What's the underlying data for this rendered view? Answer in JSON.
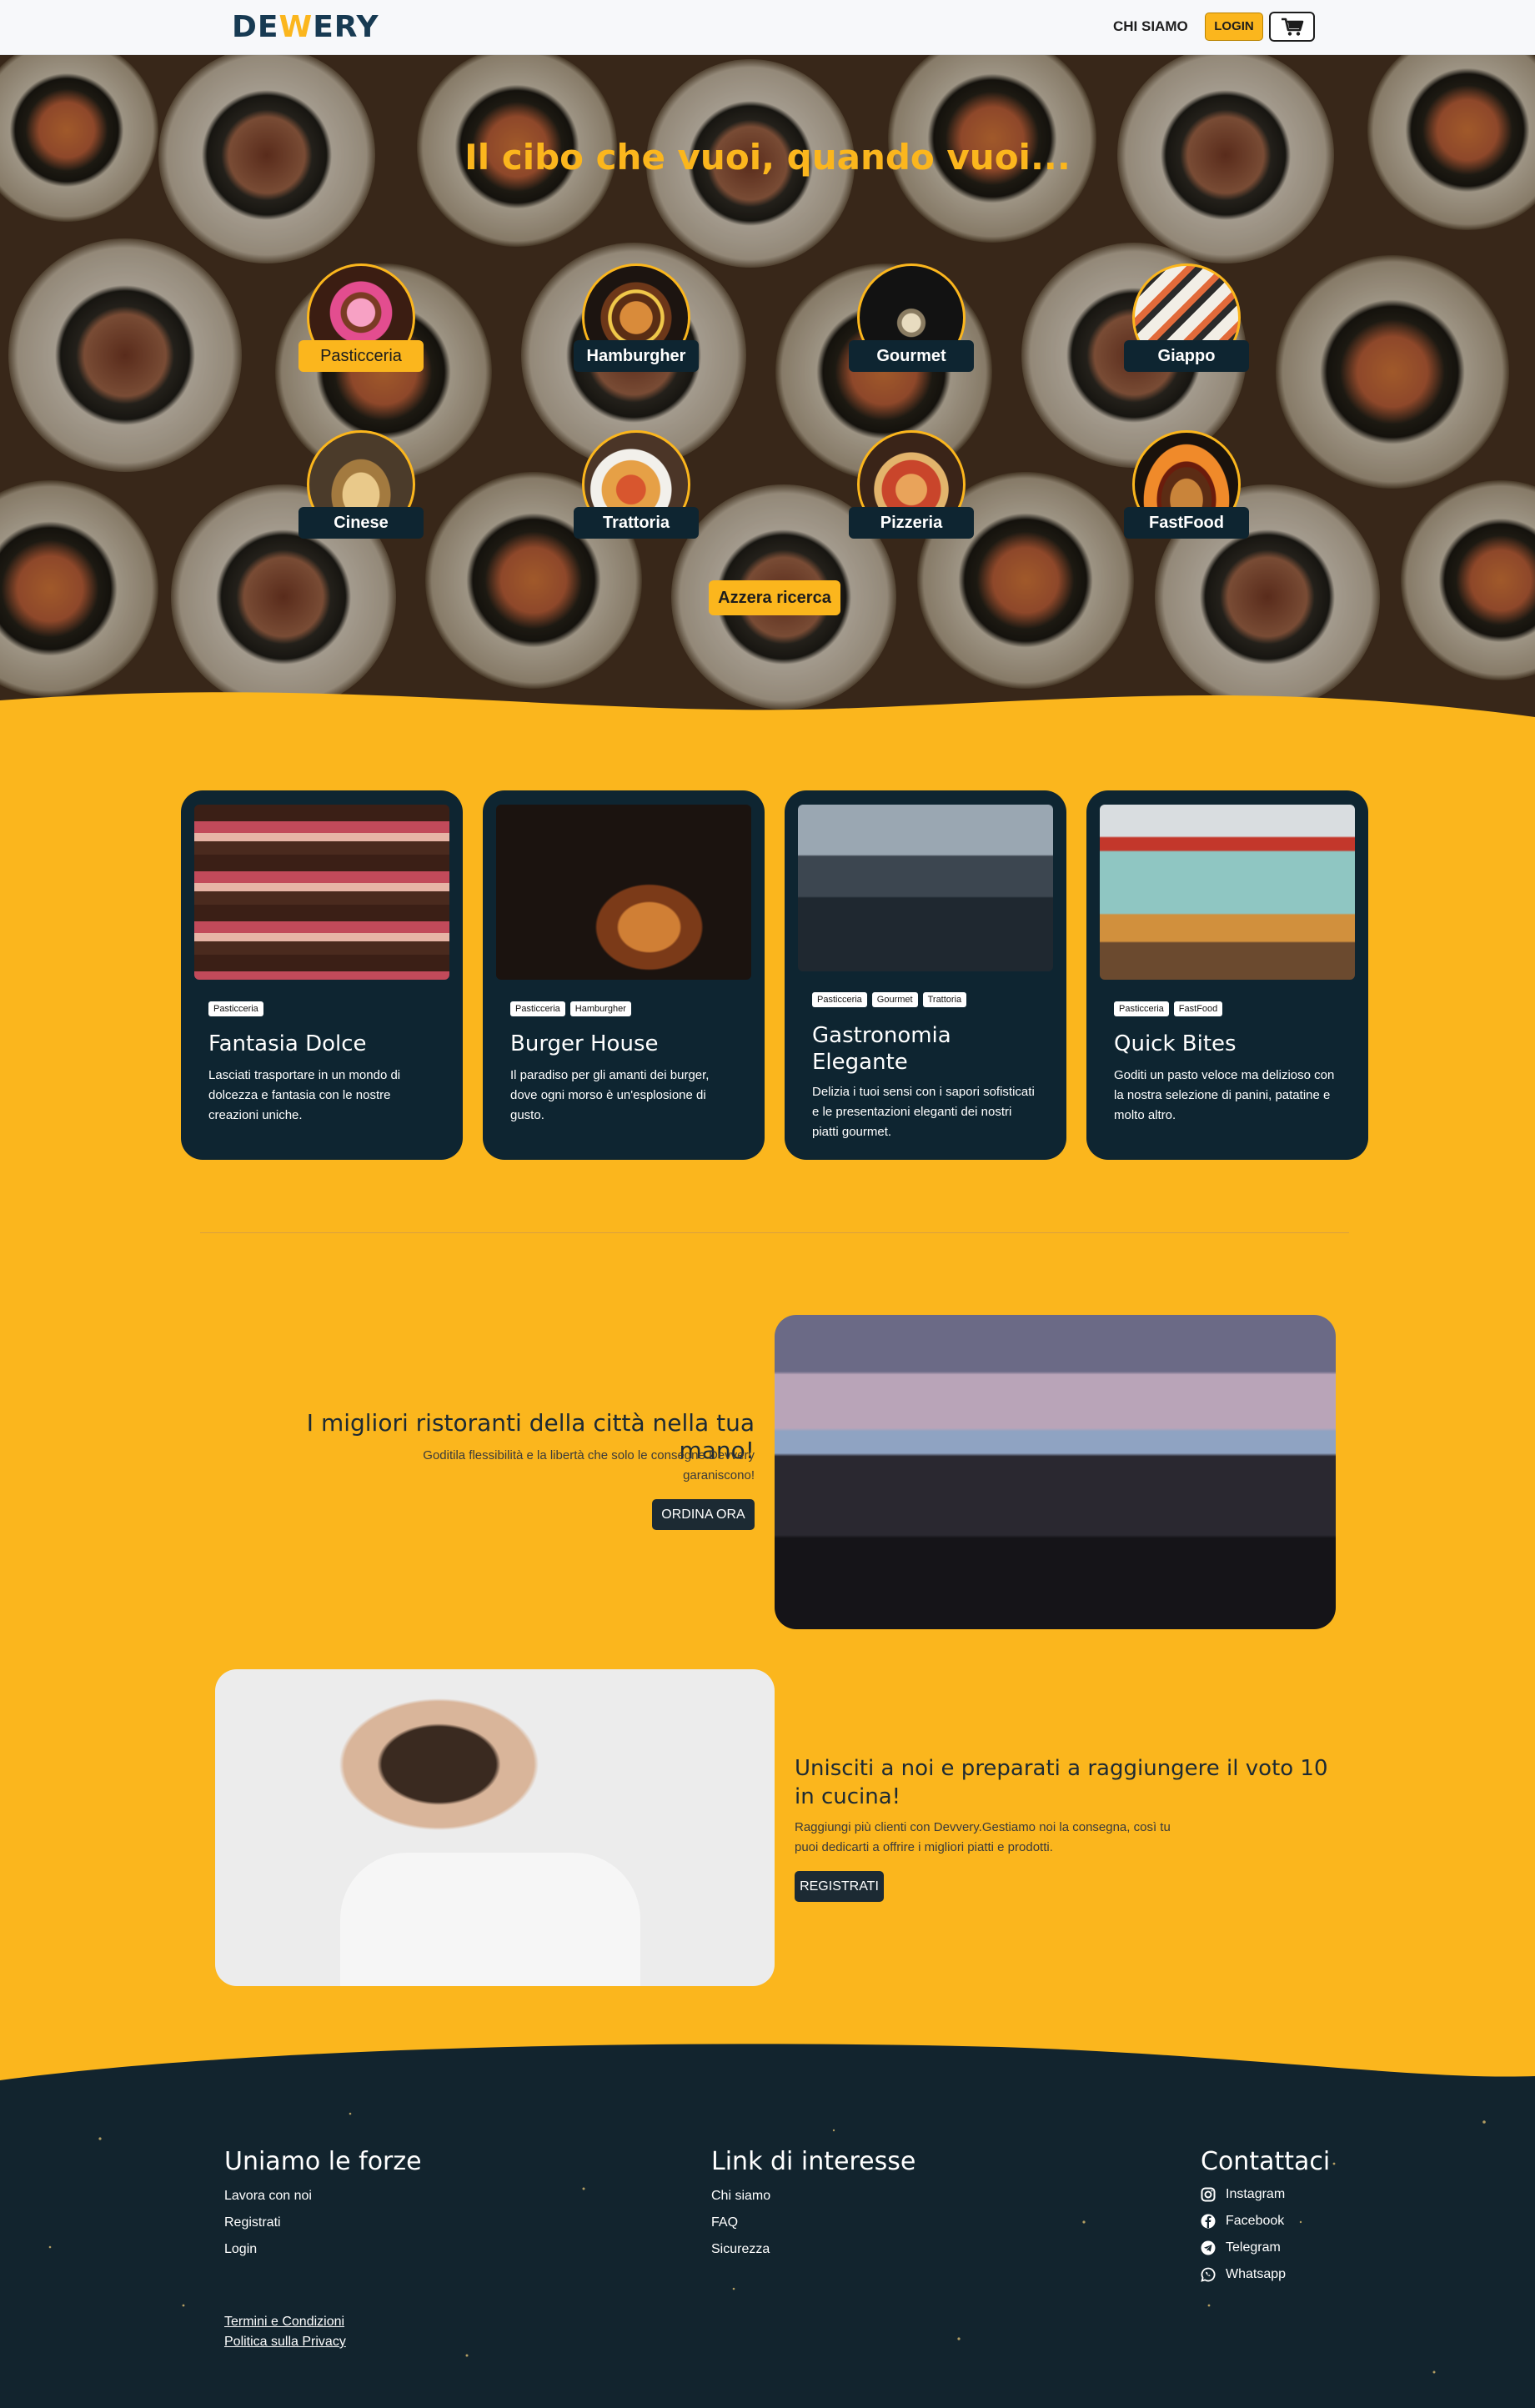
{
  "brand": {
    "logo_prefix": "DE",
    "logo_w": "W",
    "logo_suffix": "ERY"
  },
  "nav": {
    "chi_siamo": "CHI SIAMO",
    "login": "LOGIN",
    "cart_icon": "cart-icon"
  },
  "hero": {
    "title": "Il cibo che vuoi, quando vuoi...",
    "categories": [
      {
        "label": "Pasticceria",
        "active": true
      },
      {
        "label": "Hamburgher",
        "active": false
      },
      {
        "label": "Gourmet",
        "active": false
      },
      {
        "label": "Giappo",
        "active": false
      },
      {
        "label": "Cinese",
        "active": false
      },
      {
        "label": "Trattoria",
        "active": false
      },
      {
        "label": "Pizzeria",
        "active": false
      },
      {
        "label": "FastFood",
        "active": false
      }
    ],
    "reset": "Azzera ricerca"
  },
  "restaurants": [
    {
      "tags": [
        "Pasticceria"
      ],
      "title": "Fantasia Dolce",
      "desc": "Lasciati trasportare in un mondo di dolcezza e fantasia con le nostre creazioni uniche."
    },
    {
      "tags": [
        "Pasticceria",
        "Hamburgher"
      ],
      "title": "Burger House",
      "desc": "Il paradiso per gli amanti dei burger, dove ogni morso è un'esplosione di gusto."
    },
    {
      "tags": [
        "Pasticceria",
        "Gourmet",
        "Trattoria"
      ],
      "title": "Gastronomia Elegante",
      "desc": "Delizia i tuoi sensi con i sapori sofisticati e le presentazioni eleganti dei nostri piatti gourmet."
    },
    {
      "tags": [
        "Pasticceria",
        "FastFood"
      ],
      "title": "Quick Bites",
      "desc": "Goditi un pasto veloce ma delizioso con la nostra selezione di panini, patatine e molto altro."
    }
  ],
  "promo1": {
    "title": "I migliori ristoranti della città nella tua mano!",
    "desc": "Goditila flessibilità e la libertà che solo le consegne Devvery garaniscono!",
    "button": "ORDINA ORA"
  },
  "promo2": {
    "title": "Unisciti a noi e preparati a raggiungere il voto 10 in cucina!",
    "desc": "Raggiungi più clienti con Devvery.Gestiamo noi la consegna, così tu puoi dedicarti a offrire i migliori piatti e prodotti.",
    "button": "REGISTRATI"
  },
  "footer": {
    "col1": {
      "title": "Uniamo le forze",
      "links": [
        "Lavora con noi",
        "Registrati",
        "Login"
      ]
    },
    "col2": {
      "title": "Link di interesse",
      "links": [
        "Chi siamo",
        "FAQ",
        "Sicurezza"
      ]
    },
    "col3": {
      "title": "Contattaci",
      "links": [
        "Instagram",
        "Facebook",
        "Telegram",
        "Whatsapp"
      ]
    },
    "legal": [
      "Termini e Condizioni",
      "Politica sulla Privacy"
    ]
  },
  "colors": {
    "accent": "#fbb61d",
    "dark": "#0e2531",
    "footer": "#12242e"
  }
}
